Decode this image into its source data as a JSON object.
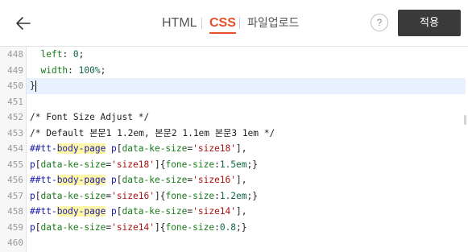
{
  "header": {
    "tabs": [
      {
        "label": "HTML",
        "active": false
      },
      {
        "label": "CSS",
        "active": true
      },
      {
        "label": "파일업로드",
        "active": false
      }
    ],
    "help_label": "?",
    "apply_label": "적용"
  },
  "editor": {
    "lines": [
      {
        "num": "448",
        "text": "  left: 0;"
      },
      {
        "num": "449",
        "text": "  width: 100%;"
      },
      {
        "num": "450",
        "text": "}"
      },
      {
        "num": "451",
        "text": ""
      },
      {
        "num": "452",
        "text": "/* Font Size Adjust */"
      },
      {
        "num": "453",
        "text": "/* Default 본문1 1.2em, 본문2 1.1em 본문3 1em */"
      },
      {
        "num": "454",
        "text": "##tt-body-page p[data-ke-size='size18'],"
      },
      {
        "num": "455",
        "text": "p[data-ke-size='size18']{fone-size:1.5em;}"
      },
      {
        "num": "456",
        "text": "##tt-body-page p[data-ke-size='size16'],"
      },
      {
        "num": "457",
        "text": "p[data-ke-size='size16']{fone-size:1.2em;}"
      },
      {
        "num": "458",
        "text": "##tt-body-page p[data-ke-size='size14'],"
      },
      {
        "num": "459",
        "text": "p[data-ke-size='size14']{fone-size:0.8;}"
      },
      {
        "num": "460",
        "text": ""
      }
    ],
    "active_line": "450"
  },
  "colors": {
    "accent": "#e8502a",
    "apply_bg": "#3a3a3a",
    "active_line_bg": "#e8f2ff",
    "search_highlight": "#fff7a8"
  }
}
